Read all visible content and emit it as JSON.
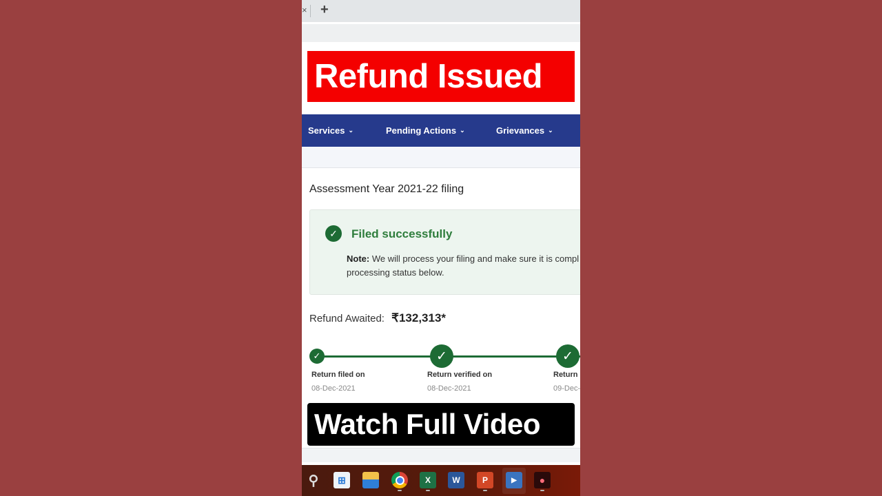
{
  "browser": {
    "new_tab_icon": "plus-icon",
    "new_tab_glyph": "+",
    "close_tab_glyph": "×"
  },
  "overlay": {
    "top_banner": "Refund Issued",
    "bottom_banner": "Watch Full Video",
    "top_banner_color": "#f40000",
    "bottom_banner_color": "#000000"
  },
  "nav": {
    "items": [
      {
        "label": "Services",
        "chevron": "⌄"
      },
      {
        "label": "Pending Actions",
        "chevron": "⌄"
      },
      {
        "label": "Grievances",
        "chevron": "⌄"
      }
    ],
    "color": "#263a8c"
  },
  "filing": {
    "title": "Assessment Year 2021-22 filing",
    "status_icon": "check-circle-icon",
    "status_glyph": "✓",
    "status_title": "Filed successfully",
    "note_label": "Note:",
    "note_line1": " We will process your filing and make sure it is compl",
    "note_line2": "processing status below.",
    "success_color": "#1d6b34"
  },
  "refund": {
    "label": "Refund Awaited:",
    "amount": "₹132,313*"
  },
  "timeline": {
    "steps": [
      {
        "label": "Return filed on",
        "date": "08-Dec-2021",
        "glyph": "✓"
      },
      {
        "label": "Return verified on",
        "date": "08-Dec-2021",
        "glyph": "✓"
      },
      {
        "label": "Return p",
        "date": "09-Dec-",
        "glyph": "✓"
      }
    ]
  },
  "taskbar": {
    "icons": [
      {
        "name": "search",
        "glyph": "⚲"
      },
      {
        "name": "microsoft-store",
        "glyph": "⊞"
      },
      {
        "name": "file-explorer",
        "glyph": ""
      },
      {
        "name": "chrome",
        "glyph": ""
      },
      {
        "name": "excel",
        "glyph": "X"
      },
      {
        "name": "word",
        "glyph": "W"
      },
      {
        "name": "powerpoint",
        "glyph": "P"
      },
      {
        "name": "media-player",
        "glyph": "▶"
      },
      {
        "name": "screen-recorder",
        "glyph": "●"
      }
    ]
  }
}
